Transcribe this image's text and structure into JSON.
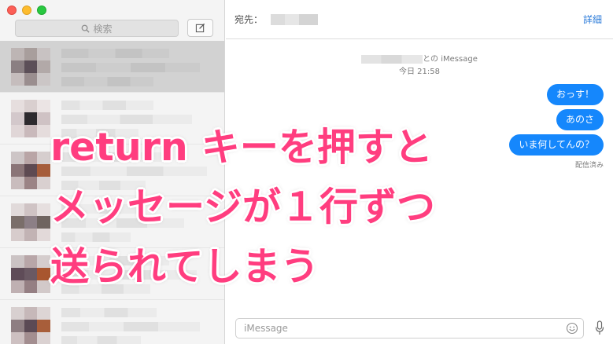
{
  "window": {
    "traffic_lights": [
      "close",
      "minimize",
      "zoom"
    ]
  },
  "sidebar": {
    "search_placeholder": "検索",
    "compose_icon": "compose-icon"
  },
  "header": {
    "to_label": "宛先：",
    "details_label": "詳細"
  },
  "conversation": {
    "service_suffix": "との iMessage",
    "timestamp": "今日 21:58",
    "messages": [
      "おっす！",
      "あのさ",
      "いま何してんの？"
    ],
    "status": "配信済み"
  },
  "composer": {
    "placeholder": "iMessage"
  },
  "overlay": {
    "line1": "return キーを押すと",
    "line2": "メッセージが１行ずつ",
    "line3": "送られてしまう"
  },
  "colors": {
    "bubble": "#1587fc",
    "accent_link": "#2b7bd9",
    "overlay_text": "#ff3d7f"
  }
}
